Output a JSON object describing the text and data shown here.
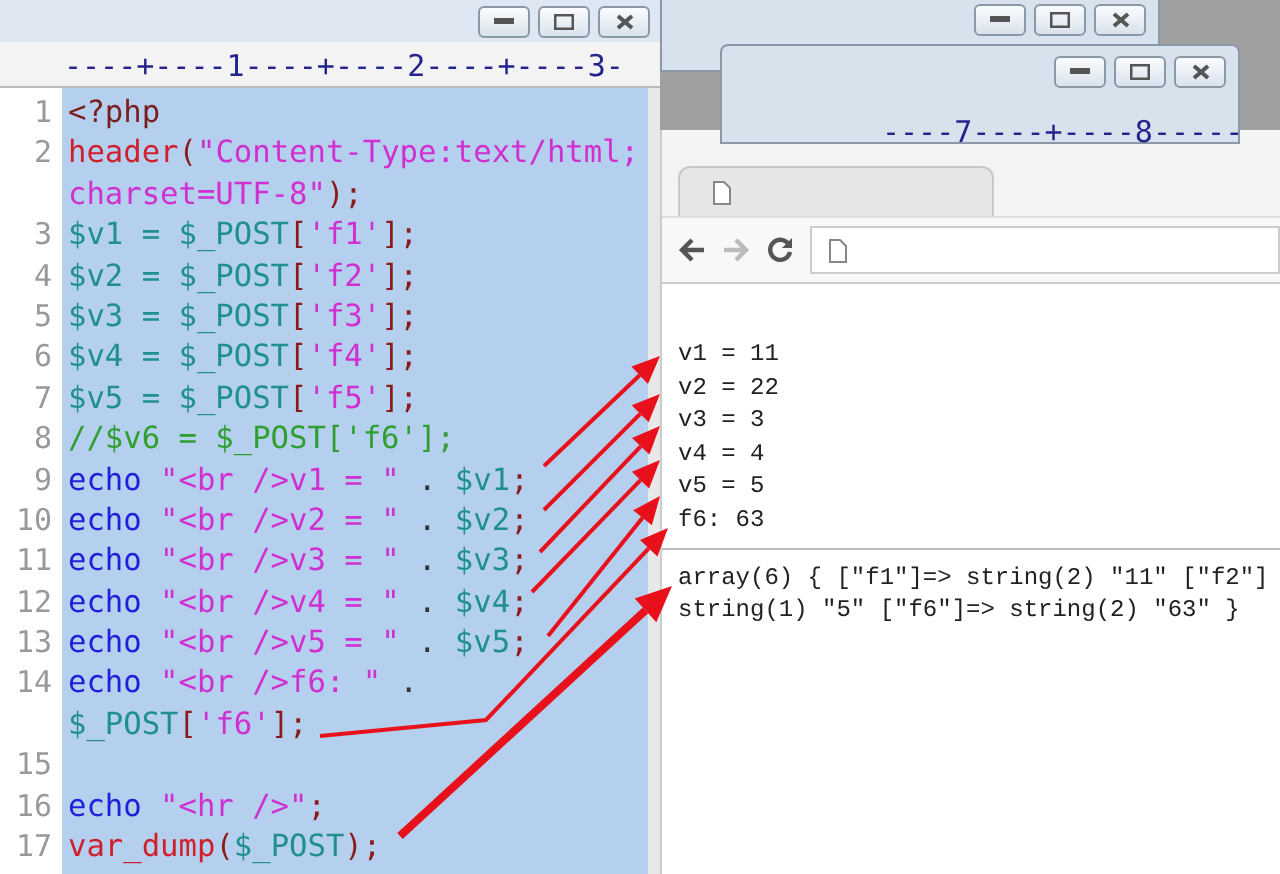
{
  "editor": {
    "ruler": "----+----1----+----2----+----3-",
    "rows": [
      {
        "number": "1",
        "tokens": [
          {
            "kind": "tag",
            "text": "<?php"
          }
        ]
      },
      {
        "number": "2",
        "tokens": [
          {
            "kind": "func",
            "text": "header"
          },
          {
            "kind": "punct",
            "text": "("
          },
          {
            "kind": "string",
            "text": "\"Content-Type:text/html;"
          }
        ]
      },
      {
        "tokens": [
          {
            "kind": "string",
            "text": "charset=UTF-8\""
          },
          {
            "kind": "punct",
            "text": ");"
          }
        ]
      },
      {
        "number": "3",
        "tokens": [
          {
            "kind": "var",
            "text": "$v1 = $_POST"
          },
          {
            "kind": "punct",
            "text": "["
          },
          {
            "kind": "string",
            "text": "'f1'"
          },
          {
            "kind": "punct",
            "text": "];"
          }
        ]
      },
      {
        "number": "4",
        "tokens": [
          {
            "kind": "var",
            "text": "$v2 = $_POST"
          },
          {
            "kind": "punct",
            "text": "["
          },
          {
            "kind": "string",
            "text": "'f2'"
          },
          {
            "kind": "punct",
            "text": "];"
          }
        ]
      },
      {
        "number": "5",
        "tokens": [
          {
            "kind": "var",
            "text": "$v3 = $_POST"
          },
          {
            "kind": "punct",
            "text": "["
          },
          {
            "kind": "string",
            "text": "'f3'"
          },
          {
            "kind": "punct",
            "text": "];"
          }
        ]
      },
      {
        "number": "6",
        "tokens": [
          {
            "kind": "var",
            "text": "$v4 = $_POST"
          },
          {
            "kind": "punct",
            "text": "["
          },
          {
            "kind": "string",
            "text": "'f4'"
          },
          {
            "kind": "punct",
            "text": "];"
          }
        ]
      },
      {
        "number": "7",
        "tokens": [
          {
            "kind": "var",
            "text": "$v5 = $_POST"
          },
          {
            "kind": "punct",
            "text": "["
          },
          {
            "kind": "string",
            "text": "'f5'"
          },
          {
            "kind": "punct",
            "text": "];"
          }
        ]
      },
      {
        "number": "8",
        "tokens": [
          {
            "kind": "comment",
            "text": "//$v6 = $_POST['f6'];"
          }
        ]
      },
      {
        "number": "9",
        "tokens": [
          {
            "kind": "keyword",
            "text": "echo"
          },
          {
            "kind": "string",
            "text": " \"<br />v1 = \""
          },
          {
            "kind": "op",
            "text": " . "
          },
          {
            "kind": "var",
            "text": "$v1"
          },
          {
            "kind": "punct",
            "text": ";"
          }
        ]
      },
      {
        "number": "10",
        "tokens": [
          {
            "kind": "keyword",
            "text": "echo"
          },
          {
            "kind": "string",
            "text": " \"<br />v2 = \""
          },
          {
            "kind": "op",
            "text": " . "
          },
          {
            "kind": "var",
            "text": "$v2"
          },
          {
            "kind": "punct",
            "text": ";"
          }
        ]
      },
      {
        "number": "11",
        "tokens": [
          {
            "kind": "keyword",
            "text": "echo"
          },
          {
            "kind": "string",
            "text": " \"<br />v3 = \""
          },
          {
            "kind": "op",
            "text": " . "
          },
          {
            "kind": "var",
            "text": "$v3"
          },
          {
            "kind": "punct",
            "text": ";"
          }
        ]
      },
      {
        "number": "12",
        "tokens": [
          {
            "kind": "keyword",
            "text": "echo"
          },
          {
            "kind": "string",
            "text": " \"<br />v4 = \""
          },
          {
            "kind": "op",
            "text": " . "
          },
          {
            "kind": "var",
            "text": "$v4"
          },
          {
            "kind": "punct",
            "text": ";"
          }
        ]
      },
      {
        "number": "13",
        "tokens": [
          {
            "kind": "keyword",
            "text": "echo"
          },
          {
            "kind": "string",
            "text": " \"<br />v5 = \""
          },
          {
            "kind": "op",
            "text": " . "
          },
          {
            "kind": "var",
            "text": "$v5"
          },
          {
            "kind": "punct",
            "text": ";"
          }
        ]
      },
      {
        "number": "14",
        "tokens": [
          {
            "kind": "keyword",
            "text": "echo"
          },
          {
            "kind": "string",
            "text": " \"<br />f6: \""
          },
          {
            "kind": "op",
            "text": " ."
          }
        ]
      },
      {
        "tokens": [
          {
            "kind": "var",
            "text": "$_POST"
          },
          {
            "kind": "punct",
            "text": "["
          },
          {
            "kind": "string",
            "text": "'f6'"
          },
          {
            "kind": "punct",
            "text": "];"
          }
        ]
      },
      {
        "number": "15"
      },
      {
        "number": "16",
        "tokens": [
          {
            "kind": "keyword",
            "text": "echo"
          },
          {
            "kind": "string",
            "text": " \"<hr />\""
          },
          {
            "kind": "punct",
            "text": ";"
          }
        ]
      },
      {
        "number": "17",
        "tokens": [
          {
            "kind": "func",
            "text": "var_dump"
          },
          {
            "kind": "punct",
            "text": "("
          },
          {
            "kind": "var",
            "text": "$_POST"
          },
          {
            "kind": "punct",
            "text": ");"
          }
        ]
      }
    ]
  },
  "background_window": {
    "ruler": "----7----+----8-----"
  },
  "browser": {
    "output_lines": [
      "v1 = 11",
      "v2 = 22",
      "v3 = 3",
      "v4 = 4",
      "v5 = 5",
      "f6: 63"
    ],
    "dump_lines": [
      "array(6) { [\"f1\"]=> string(2) \"11\" [\"f2\"]",
      "string(1) \"5\" [\"f6\"]=> string(2) \"63\" }"
    ]
  }
}
